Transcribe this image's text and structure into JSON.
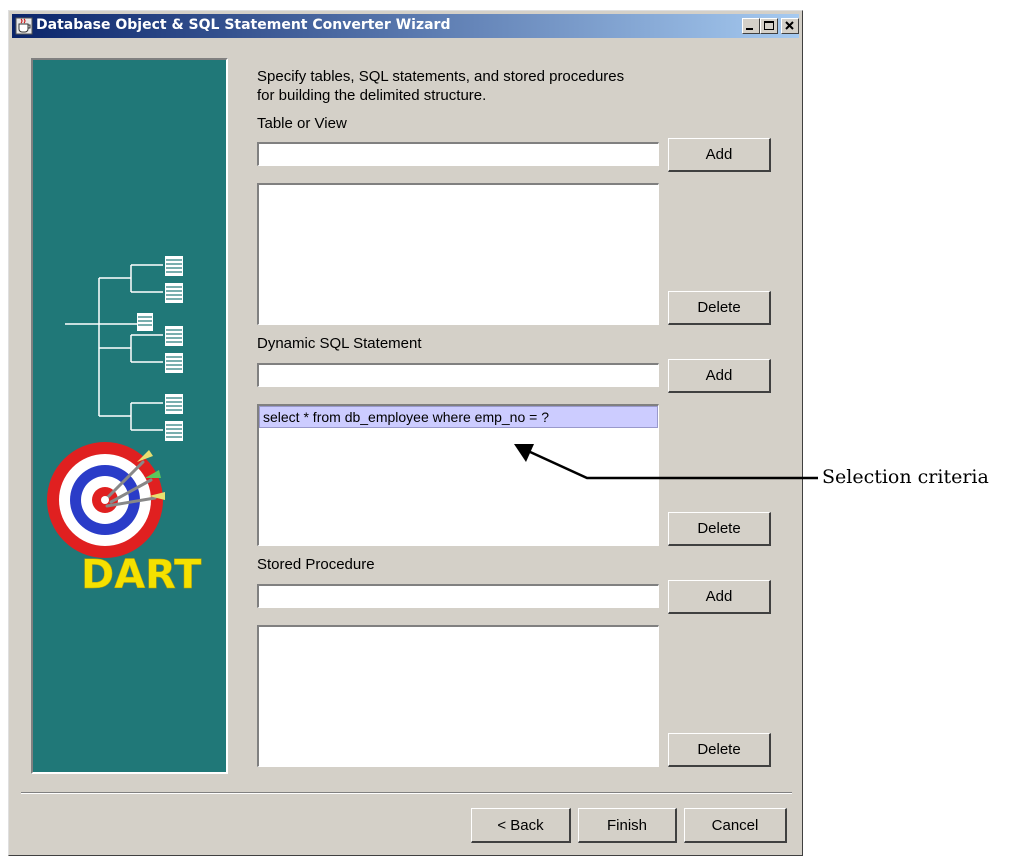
{
  "window": {
    "title": "Database Object & SQL Statement Converter Wizard",
    "min_symbol": "_",
    "max_symbol": "□",
    "close_symbol": "×"
  },
  "banner": {
    "logo_text": "DART"
  },
  "instructions": {
    "line1": "Specify tables, SQL statements, and stored procedures",
    "line2": "for building the delimited structure."
  },
  "table_section": {
    "label": "Table or View",
    "input_value": "",
    "add_label": "Add",
    "delete_label": "Delete",
    "items": []
  },
  "sql_section": {
    "label": "Dynamic SQL Statement",
    "input_value": "",
    "add_label": "Add",
    "delete_label": "Delete",
    "items": [
      "select * from db_employee where emp_no = ?"
    ]
  },
  "proc_section": {
    "label": "Stored Procedure",
    "input_value": "",
    "add_label": "Add",
    "delete_label": "Delete",
    "items": []
  },
  "footer": {
    "back_label": "< Back",
    "finish_label": "Finish",
    "cancel_label": "Cancel"
  },
  "annotation": {
    "text": "Selection criteria"
  },
  "colors": {
    "title_gradient_start": "#0a246a",
    "title_gradient_end": "#a6caf0",
    "banner_bg": "#207878",
    "dialog_bg": "#d4d0c8",
    "selection_bg": "#ccccff",
    "logo_yellow": "#f5e100"
  }
}
